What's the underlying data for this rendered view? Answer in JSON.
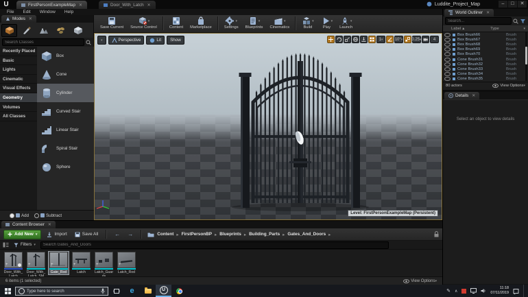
{
  "window": {
    "logo": "U",
    "tabs": [
      {
        "label": "FirstPersonExampleMap"
      },
      {
        "label": "Door_With_Latch"
      }
    ],
    "title": "Luddite_Project_Map",
    "menu": [
      "File",
      "Edit",
      "Window",
      "Help"
    ]
  },
  "modes": {
    "tab": "Modes",
    "search_placeholder": "Search Classes",
    "categories": [
      "Recently Placed",
      "Basic",
      "Lights",
      "Cinematic",
      "Visual Effects",
      "Geometry",
      "Volumes",
      "All Classes"
    ],
    "items": [
      "Box",
      "Cone",
      "Cylinder",
      "Curved Stair",
      "Linear Stair",
      "Spiral Stair",
      "Sphere"
    ],
    "add_label": "Add",
    "subtract_label": "Subtract"
  },
  "toolbar": {
    "buttons": [
      "Save Current",
      "Source Control",
      "Content",
      "Marketplace",
      "Settings",
      "Blueprints",
      "Cinematics",
      "Build",
      "Play",
      "Launch"
    ]
  },
  "viewport": {
    "perspective_label": "Perspective",
    "lit_label": "Lit",
    "show_label": "Show",
    "grid_size": "1",
    "rotation_snap": "10°",
    "scale_snap": "0.25",
    "camera_speed": "4",
    "level_label": "Level: FirstPersonExampleMap (Persistent)"
  },
  "world_outliner": {
    "tab": "World Outliner",
    "search_placeholder": "Search...",
    "columns": {
      "label": "Label",
      "type": "Type"
    },
    "rows": [
      {
        "label": "Box Brush66",
        "type": "Brush"
      },
      {
        "label": "Box Brush67",
        "type": "Brush"
      },
      {
        "label": "Box Brush68",
        "type": "Brush"
      },
      {
        "label": "Box Brush69",
        "type": "Brush"
      },
      {
        "label": "Box Brush70",
        "type": "Brush"
      },
      {
        "label": "Cone Brush31",
        "type": "Brush"
      },
      {
        "label": "Cone Brush32",
        "type": "Brush"
      },
      {
        "label": "Cone Brush33",
        "type": "Brush"
      },
      {
        "label": "Cone Brush34",
        "type": "Brush"
      },
      {
        "label": "Cone Brush35",
        "type": "Brush"
      }
    ],
    "footer": "80 actors",
    "view_options": "View Options"
  },
  "details": {
    "tab": "Details",
    "empty_text": "Select an object to view details"
  },
  "content_browser": {
    "tab": "Content Browser",
    "add_new": "Add New",
    "import": "Import",
    "save_all": "Save All",
    "breadcrumbs": [
      "Content",
      "FirstPersonBP",
      "Blueprints",
      "Building_Parts",
      "Gates_And_Doors"
    ],
    "filters": "Filters",
    "search_placeholder": "Search Gates_And_Doors",
    "assets": [
      {
        "name": "Door_With_Latch",
        "underline": "#2a50c8"
      },
      {
        "name": "Door_With_Latch_SM",
        "underline": "#00c8d4"
      },
      {
        "name": "Gate_Rod",
        "underline": "#00c8d4"
      },
      {
        "name": "Latch",
        "underline": "#00c8d4"
      },
      {
        "name": "Latch_Guards",
        "underline": "#00c8d4"
      },
      {
        "name": "Latch_Rod",
        "underline": "#00c8d4"
      }
    ],
    "footer": "6 items (1 selected)",
    "view_options": "View Options"
  },
  "taskbar": {
    "search_placeholder": "Type here to search",
    "time": "11:18",
    "date": "07/11/2019"
  },
  "colors": {
    "accent_orange": "#b0761f",
    "selection_grey": "#56595e",
    "add_new_green": "#3f8b2f",
    "taskbar_active_blue": "#6fb3e8"
  }
}
